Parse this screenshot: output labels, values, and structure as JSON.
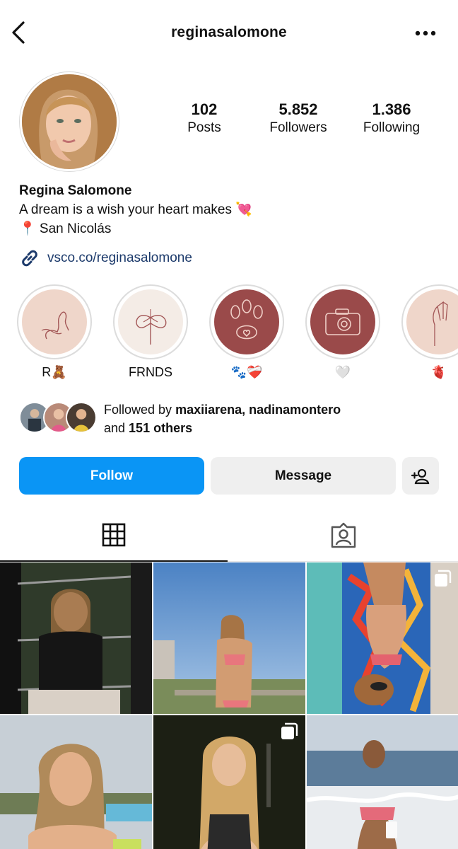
{
  "header": {
    "username": "reginasalomone"
  },
  "profile": {
    "stats": [
      {
        "value": "102",
        "label": "Posts"
      },
      {
        "value": "5.852",
        "label": "Followers"
      },
      {
        "value": "1.386",
        "label": "Following"
      }
    ],
    "name": "Regina Salomone",
    "bio_line1": "A dream is a wish your heart makes 💘",
    "bio_line2": "📍 San Nicolás",
    "link": "vsco.co/reginasalomone"
  },
  "highlights": [
    {
      "label": "R🧸"
    },
    {
      "label": "FRNDS"
    },
    {
      "label": "🐾❤️‍🩹"
    },
    {
      "label": "🤍"
    },
    {
      "label": "🫀"
    }
  ],
  "followed_by": {
    "prefix": "Followed by ",
    "names": "maxiiarena, nadinamontero",
    "and": "and ",
    "others": "151 others"
  },
  "actions": {
    "follow": "Follow",
    "message": "Message"
  },
  "colors": {
    "accent": "#0a95f5",
    "link": "#1c3a6b",
    "highlight_maroon": "#9a4a4a",
    "highlight_pink": "#efd6ca"
  },
  "icons": {
    "back": "chevron-left-icon",
    "more": "more-horizontal-icon",
    "link": "link-icon",
    "add_person": "add-person-icon",
    "grid": "grid-icon",
    "tagged": "tagged-person-icon",
    "multi": "multiple-posts-icon"
  }
}
